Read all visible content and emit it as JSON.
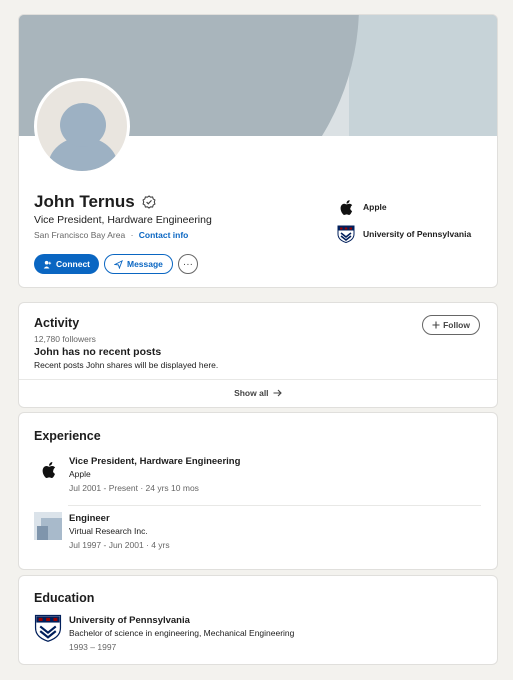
{
  "profile": {
    "name": "John Ternus",
    "headline": "Vice President, Hardware Engineering",
    "location": "San Francisco Bay Area",
    "location_separator": "·",
    "contact_info": "Contact info",
    "connect_label": "Connect",
    "message_label": "Message",
    "more_label": "···",
    "side_items": [
      {
        "label": "Apple",
        "icon": "apple-logo-icon"
      },
      {
        "label": "University of Pennsylvania",
        "icon": "penn-shield-icon"
      }
    ]
  },
  "activity": {
    "title": "Activity",
    "followers": "12,780 followers",
    "follow_label": "Follow",
    "empty_title": "John has no recent posts",
    "empty_subtitle": "Recent posts John shares will be displayed here.",
    "show_all": "Show all"
  },
  "experience": {
    "title": "Experience",
    "items": [
      {
        "title": "Vice President, Hardware Engineering",
        "company": "Apple",
        "dates": "Jul 2001 - Present · 24 yrs 10 mos",
        "icon": "apple-logo-icon"
      },
      {
        "title": "Engineer",
        "company": "Virtual Research Inc.",
        "dates": "Jul 1997 - Jun 2001 · 4 yrs",
        "icon": "company-placeholder-icon"
      }
    ]
  },
  "education": {
    "title": "Education",
    "items": [
      {
        "school": "University of Pennsylvania",
        "degree": "Bachelor of science in engineering, Mechanical Engineering",
        "dates": "1993 – 1997",
        "icon": "penn-shield-icon"
      }
    ]
  },
  "colors": {
    "accent": "#0a66c2",
    "background": "#f3f2ee",
    "banner": "#a9b5bc"
  }
}
